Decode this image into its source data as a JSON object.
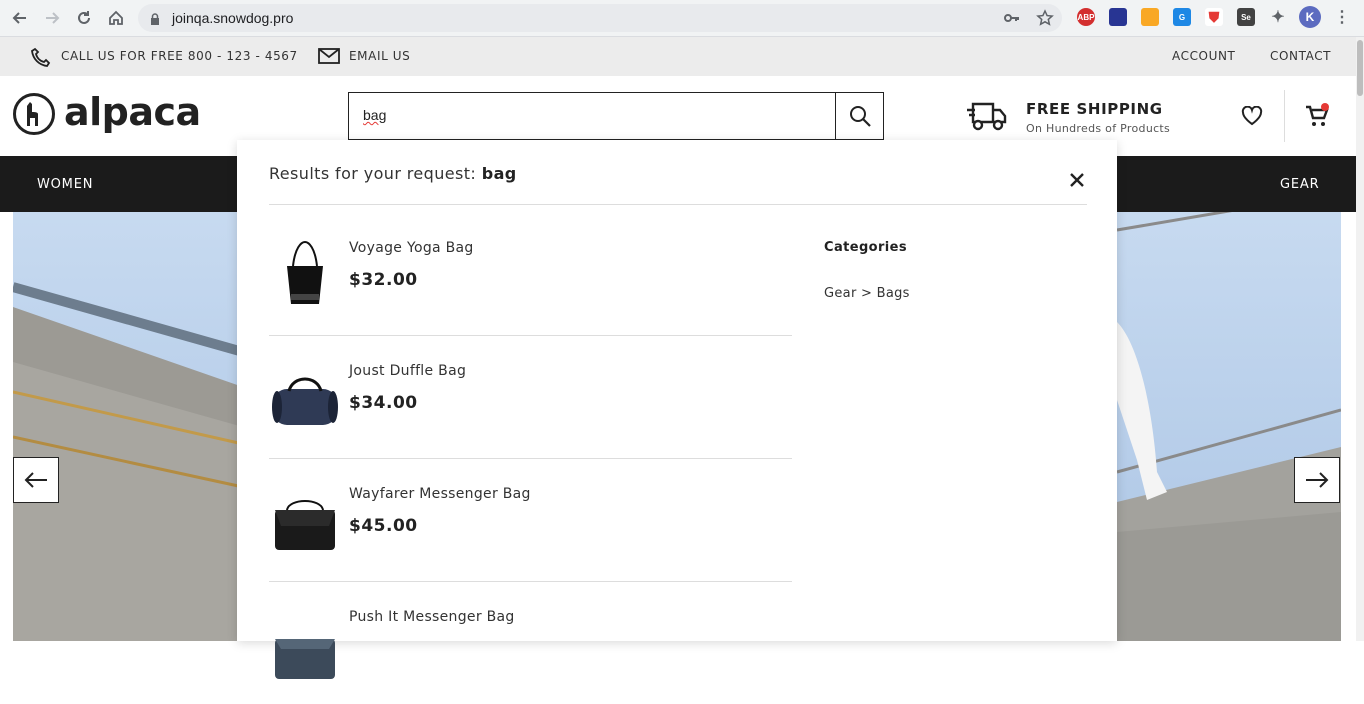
{
  "browser": {
    "url": "joinqa.snowdog.pro",
    "profile_initial": "K",
    "extensions": [
      "ABP",
      "ext",
      "mail",
      "G",
      "shield",
      "Se",
      "puzzle"
    ]
  },
  "topbar": {
    "phone": "CALL US FOR FREE 800 - 123 - 4567",
    "email": "EMAIL US",
    "account": "ACCOUNT",
    "contact": "CONTACT"
  },
  "header": {
    "logo": "alpaca",
    "search_value": "bag",
    "shipping_title": "FREE SHIPPING",
    "shipping_sub": "On Hundreds of Products",
    "cart_badge_color": "#e53935"
  },
  "nav": {
    "left_item": "WOMEN",
    "right_item": "GEAR"
  },
  "search_results": {
    "prefix": "Results for your request: ",
    "query": "bag",
    "products": [
      {
        "name": "Voyage Yoga Bag",
        "price": "$32.00"
      },
      {
        "name": "Joust Duffle Bag",
        "price": "$34.00"
      },
      {
        "name": "Wayfarer Messenger Bag",
        "price": "$45.00"
      },
      {
        "name": "Push It Messenger Bag",
        "price": ""
      }
    ],
    "categories_title": "Categories",
    "categories": [
      "Gear > Bags"
    ]
  }
}
